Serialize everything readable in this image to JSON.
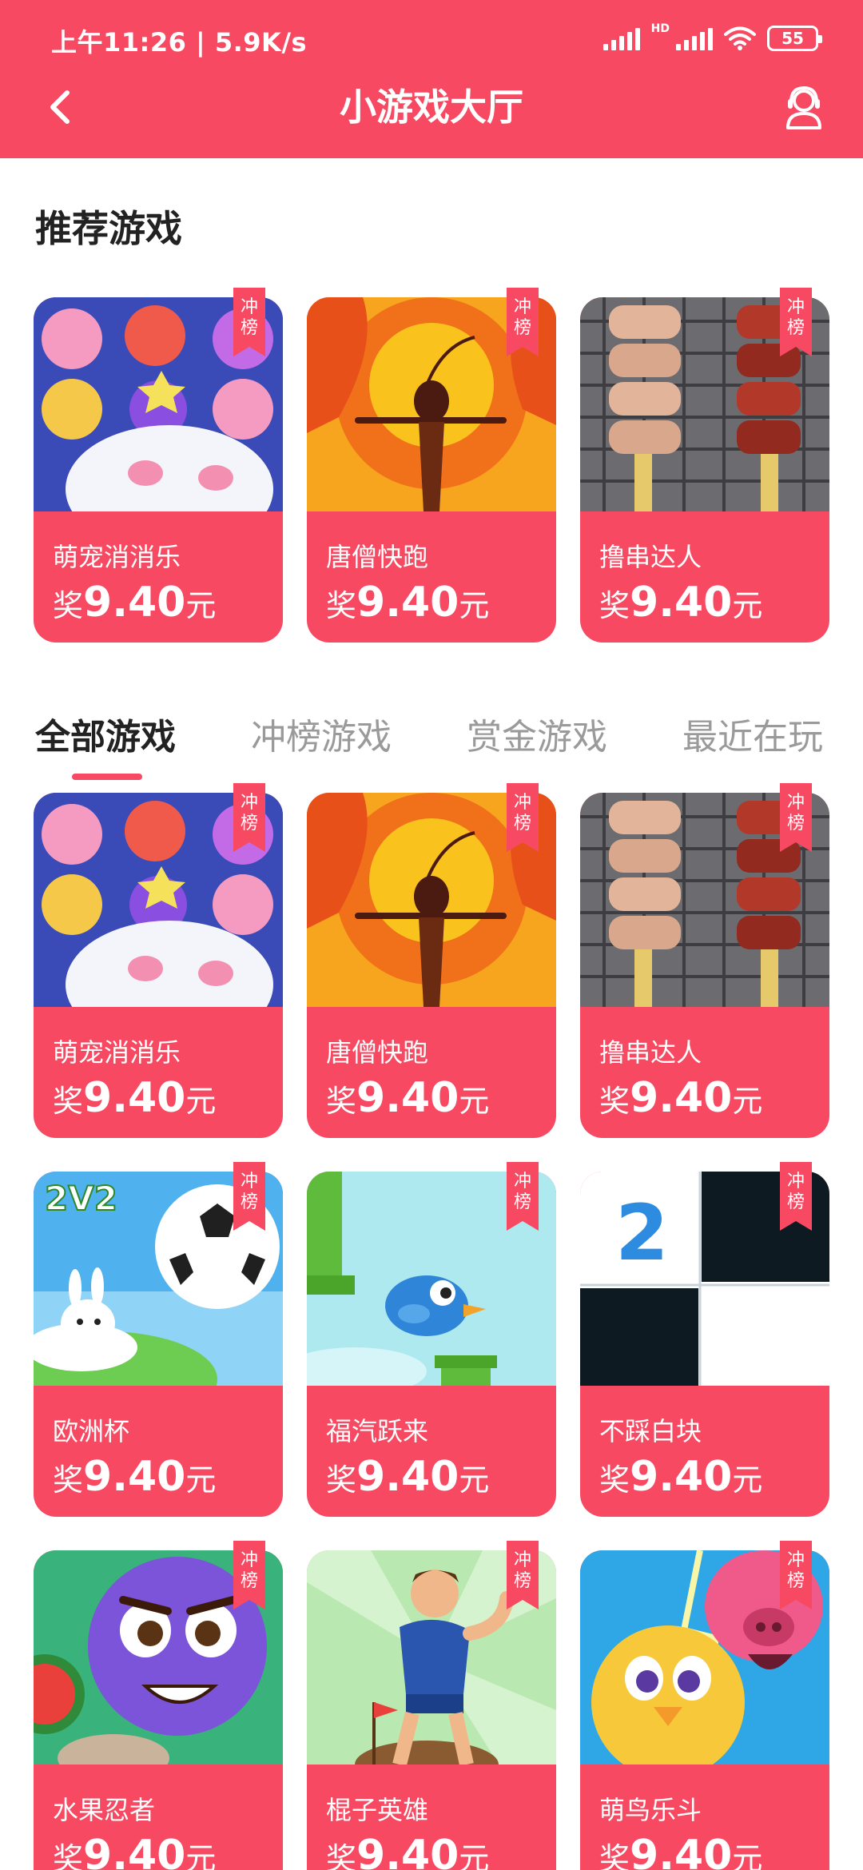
{
  "status_bar": {
    "time": "上午11:26 | 5.9K/s",
    "hd_label": "HD",
    "battery": "55"
  },
  "nav": {
    "title": "小游戏大厅"
  },
  "recommended": {
    "title": "推荐游戏",
    "games": [
      {
        "name": "萌宠消消乐",
        "reward_prefix": "奖",
        "reward_amount": "9.40",
        "reward_unit": "元",
        "badge": "冲榜"
      },
      {
        "name": "唐僧快跑",
        "reward_prefix": "奖",
        "reward_amount": "9.40",
        "reward_unit": "元",
        "badge": "冲榜"
      },
      {
        "name": "撸串达人",
        "reward_prefix": "奖",
        "reward_amount": "9.40",
        "reward_unit": "元",
        "badge": "冲榜"
      }
    ]
  },
  "tabs": [
    {
      "label": "全部游戏",
      "active": true
    },
    {
      "label": "冲榜游戏",
      "active": false
    },
    {
      "label": "赏金游戏",
      "active": false
    },
    {
      "label": "最近在玩",
      "active": false
    }
  ],
  "all_games": [
    {
      "name": "萌宠消消乐",
      "reward_prefix": "奖",
      "reward_amount": "9.40",
      "reward_unit": "元",
      "badge": "冲榜"
    },
    {
      "name": "唐僧快跑",
      "reward_prefix": "奖",
      "reward_amount": "9.40",
      "reward_unit": "元",
      "badge": "冲榜"
    },
    {
      "name": "撸串达人",
      "reward_prefix": "奖",
      "reward_amount": "9.40",
      "reward_unit": "元",
      "badge": "冲榜"
    },
    {
      "name": "欧洲杯",
      "reward_prefix": "奖",
      "reward_amount": "9.40",
      "reward_unit": "元",
      "badge": "冲榜",
      "thumb_text": "2V2"
    },
    {
      "name": "福汽跃来",
      "reward_prefix": "奖",
      "reward_amount": "9.40",
      "reward_unit": "元",
      "badge": "冲榜"
    },
    {
      "name": "不踩白块",
      "reward_prefix": "奖",
      "reward_amount": "9.40",
      "reward_unit": "元",
      "badge": "冲榜",
      "thumb_text": "2"
    },
    {
      "name": "水果忍者",
      "reward_prefix": "奖",
      "reward_amount": "9.40",
      "reward_unit": "元",
      "badge": "冲榜"
    },
    {
      "name": "棍子英雄",
      "reward_prefix": "奖",
      "reward_amount": "9.40",
      "reward_unit": "元",
      "badge": "冲榜"
    },
    {
      "name": "萌鸟乐斗",
      "reward_prefix": "奖",
      "reward_amount": "9.40",
      "reward_unit": "元",
      "badge": "冲榜"
    }
  ],
  "colors": {
    "accent": "#f74a62",
    "text_dark": "#222222",
    "text_muted": "#9a9a9a"
  }
}
